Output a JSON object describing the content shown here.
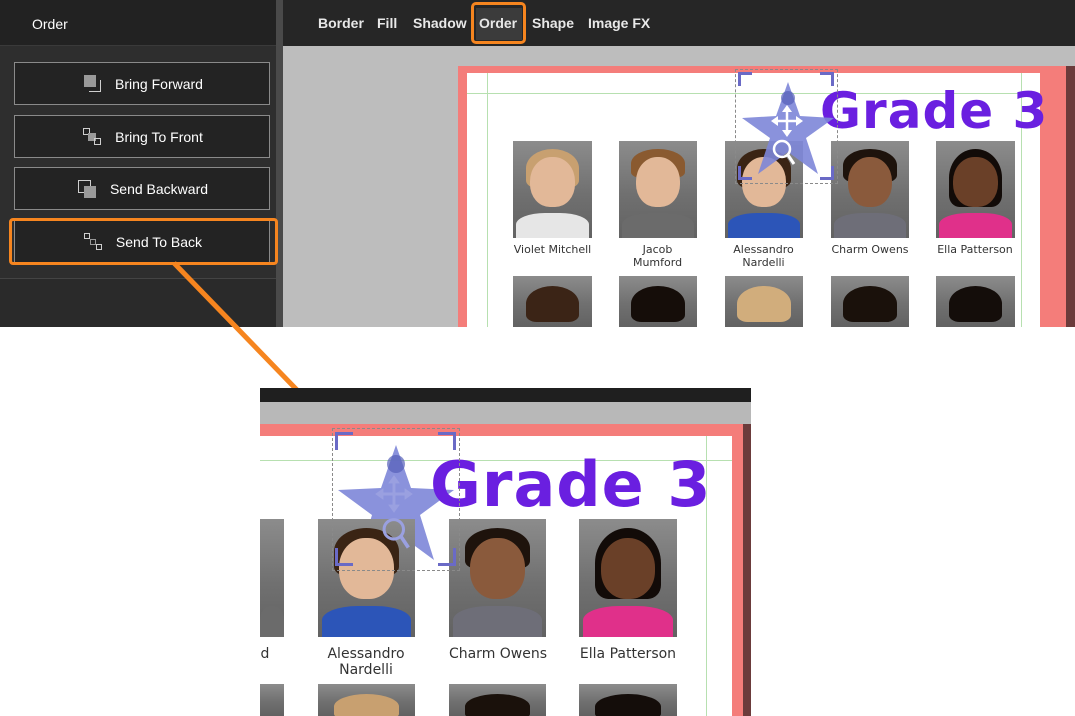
{
  "panel": {
    "title": "Order",
    "buttons": [
      {
        "label": "Bring Forward",
        "icon": "bring-forward-icon"
      },
      {
        "label": "Bring To Front",
        "icon": "bring-to-front-icon"
      },
      {
        "label": "Send Backward",
        "icon": "send-backward-icon"
      },
      {
        "label": "Send To Back",
        "icon": "send-to-back-icon"
      }
    ]
  },
  "toolbar": {
    "tabs": [
      "Border",
      "Fill",
      "Shadow",
      "Order",
      "Shape",
      "Image FX"
    ],
    "active_tab": "Order"
  },
  "page": {
    "title": "Grade 3",
    "students_row1": [
      {
        "name": "Violet Mitchell"
      },
      {
        "name": "Jacob\nMumford"
      },
      {
        "name": "Alessandro\nNardelli"
      },
      {
        "name": "Charm Owens"
      },
      {
        "name": "Ella Patterson"
      }
    ]
  },
  "zoom": {
    "title": "Grade 3",
    "names": [
      "Alessandro\nNardelli",
      "Charm Owens",
      "Ella Patterson"
    ]
  },
  "colors": {
    "highlight": "#f6851f",
    "page_border": "#f47d7a",
    "title_purple": "#6a1fe0",
    "star": "#7d86d8"
  }
}
